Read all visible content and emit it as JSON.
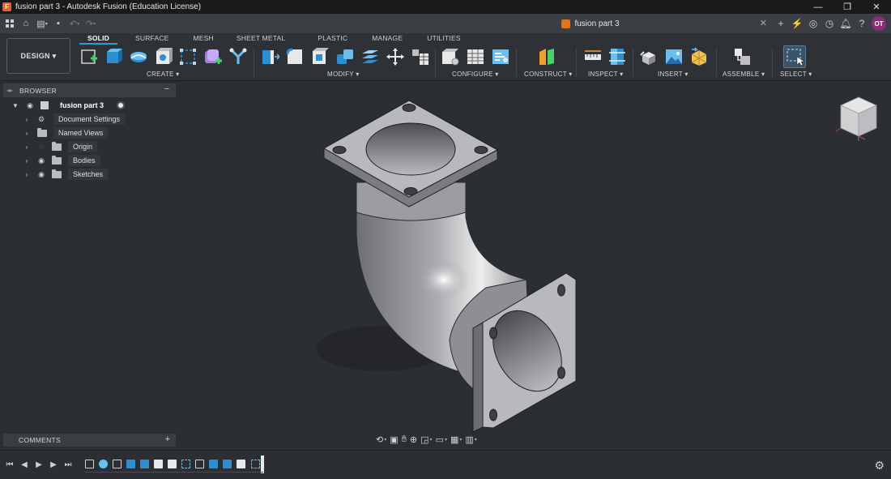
{
  "window": {
    "title": "fusion part 3 - Autodesk Fusion (Education License)",
    "logo_letter": "F",
    "controls": [
      "—",
      "❐",
      "✕"
    ]
  },
  "appbar": {
    "document_tab": "fusion part 3",
    "user_initials": "OT"
  },
  "ribbon": {
    "workspace": "DESIGN ▾",
    "tabs": [
      "SOLID",
      "SURFACE",
      "MESH",
      "SHEET METAL",
      "PLASTIC",
      "MANAGE",
      "UTILITIES"
    ],
    "active_tab": "SOLID",
    "groups": [
      "CREATE ▾",
      "MODIFY ▾",
      "CONFIGURE ▾",
      "CONSTRUCT ▾",
      "INSPECT ▾",
      "INSERT ▾",
      "ASSEMBLE ▾",
      "SELECT ▾"
    ],
    "accent_color": "#2d9bd6"
  },
  "browser": {
    "title": "BROWSER",
    "root": "fusion part 3",
    "items": [
      {
        "label": "Document Settings",
        "icon": "gear-icon"
      },
      {
        "label": "Named Views",
        "icon": "folder-icon"
      },
      {
        "label": "Origin",
        "icon": "folder-icon",
        "hidden": true
      },
      {
        "label": "Bodies",
        "icon": "folder-icon"
      },
      {
        "label": "Sketches",
        "icon": "folder-icon"
      }
    ]
  },
  "comments": {
    "title": "COMMENTS"
  }
}
